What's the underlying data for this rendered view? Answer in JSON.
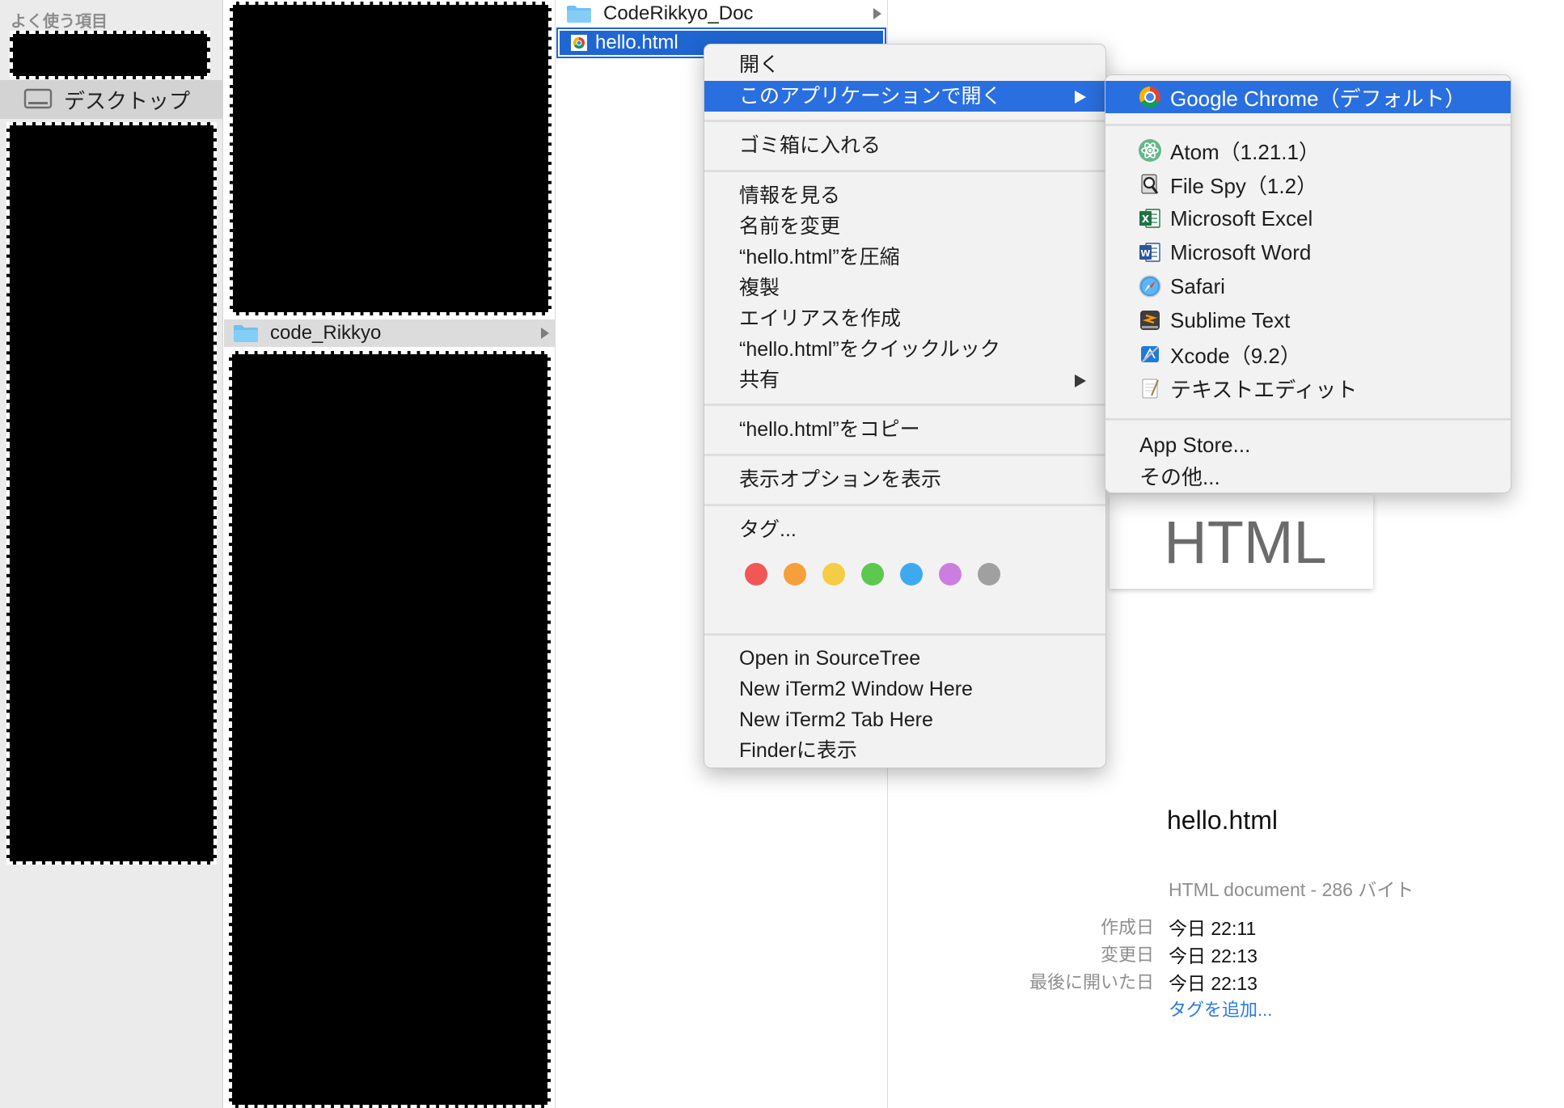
{
  "sidebar": {
    "heading": "よく使う項目",
    "selected_item": {
      "label": "デスクトップ",
      "icon": "desktop-icon"
    }
  },
  "column2": {
    "selected_folder": {
      "label": "code_Rikkyo",
      "icon": "folder-icon"
    }
  },
  "column3": {
    "items": [
      {
        "label": "CodeRikkyo_Doc",
        "icon": "folder-icon",
        "has_children": true
      },
      {
        "label": "hello.html",
        "icon": "chrome-doc-icon",
        "selected": true
      }
    ]
  },
  "context_menu": {
    "open": "開く",
    "open_with": "このアプリケーションで開く",
    "move_to_trash": "ゴミ箱に入れる",
    "get_info": "情報を見る",
    "rename": "名前を変更",
    "compress": "“hello.html”を圧縮",
    "duplicate": "複製",
    "make_alias": "エイリアスを作成",
    "quick_look": "“hello.html”をクイックルック",
    "share": "共有",
    "copy": "“hello.html”をコピー",
    "show_view_options": "表示オプションを表示",
    "tags": "タグ...",
    "tag_colors": [
      "#f25656",
      "#f5a03a",
      "#f5cd45",
      "#5cc84d",
      "#3fa9f0",
      "#cc7ee0",
      "#a0a0a0"
    ],
    "open_in_sourcetree": "Open in SourceTree",
    "new_iterm2_window": "New iTerm2 Window Here",
    "new_iterm2_tab": "New iTerm2 Tab Here",
    "reveal_in_finder": "Finderに表示"
  },
  "open_with_submenu": {
    "default_app": {
      "label": "Google Chrome（デフォルト）",
      "icon": "chrome-icon"
    },
    "apps": [
      {
        "label": "Atom（1.21.1）",
        "icon": "atom-icon"
      },
      {
        "label": "File Spy（1.2）",
        "icon": "filespy-icon"
      },
      {
        "label": "Microsoft Excel",
        "icon": "excel-icon"
      },
      {
        "label": "Microsoft Word",
        "icon": "word-icon"
      },
      {
        "label": "Safari",
        "icon": "safari-icon"
      },
      {
        "label": "Sublime Text",
        "icon": "sublime-icon"
      },
      {
        "label": "Xcode（9.2）",
        "icon": "xcode-icon"
      },
      {
        "label": "テキストエディット",
        "icon": "textedit-icon"
      }
    ],
    "app_store": "App Store...",
    "other": "その他..."
  },
  "preview": {
    "thumbnail_text": "HTML",
    "filename": "hello.html",
    "kind": "HTML document - 286 バイト",
    "meta": [
      {
        "key": "作成日",
        "value": "今日 22:11"
      },
      {
        "key": "変更日",
        "value": "今日 22:13"
      },
      {
        "key": "最後に開いた日",
        "value": "今日 22:13"
      }
    ],
    "add_tags": "タグを追加..."
  },
  "colors": {
    "selection_blue": "#2a6fe0",
    "row_selection_blue": "#1f66d2",
    "link_blue": "#2a7ae2",
    "redaction": "#000000"
  }
}
